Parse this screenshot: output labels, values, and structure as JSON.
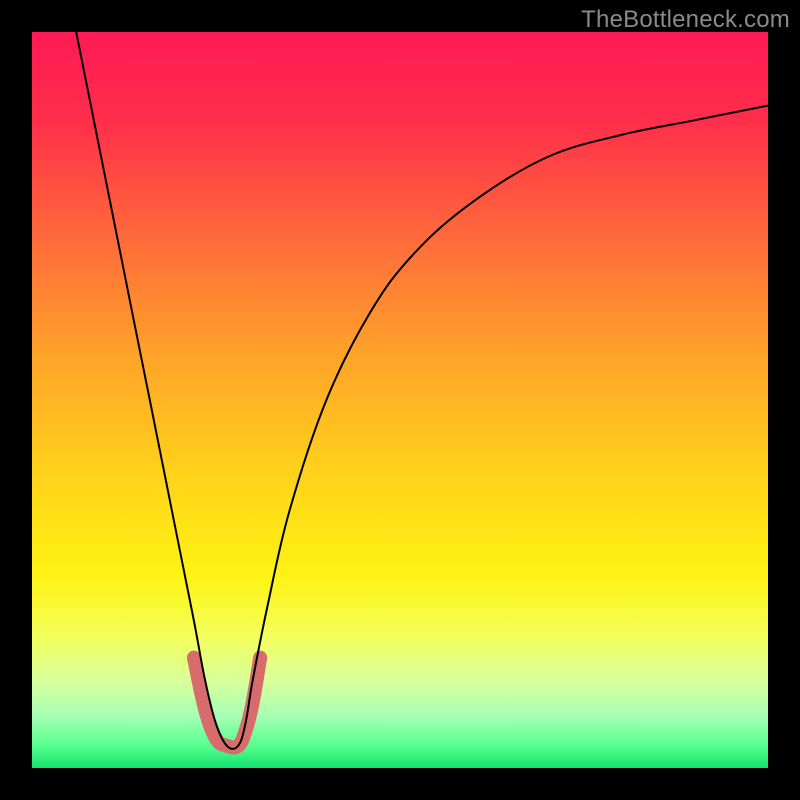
{
  "watermark": "TheBottleneck.com",
  "chart_data": {
    "type": "line",
    "title": "",
    "xlabel": "",
    "ylabel": "",
    "xlim": [
      0,
      100
    ],
    "ylim": [
      0,
      100
    ],
    "gradient_stops": [
      {
        "offset": 0.0,
        "color": "#ff1a55"
      },
      {
        "offset": 0.12,
        "color": "#ff2e4a"
      },
      {
        "offset": 0.28,
        "color": "#ff6a3a"
      },
      {
        "offset": 0.44,
        "color": "#ffa329"
      },
      {
        "offset": 0.6,
        "color": "#ffd21a"
      },
      {
        "offset": 0.74,
        "color": "#fff314"
      },
      {
        "offset": 0.82,
        "color": "#f4ff5a"
      },
      {
        "offset": 0.88,
        "color": "#d9ff9a"
      },
      {
        "offset": 0.93,
        "color": "#a6ffb4"
      },
      {
        "offset": 0.97,
        "color": "#56ff8e"
      },
      {
        "offset": 1.0,
        "color": "#12e26e"
      }
    ],
    "series": [
      {
        "name": "bottleneck-curve",
        "color": "#000000",
        "x": [
          6,
          8,
          10,
          12,
          14,
          16,
          18,
          20,
          22,
          23.5,
          25,
          26.5,
          28,
          29,
          30,
          32,
          35,
          40,
          46,
          52,
          60,
          70,
          80,
          90,
          100
        ],
        "y": [
          100,
          90,
          80,
          70,
          60,
          50,
          40,
          30,
          20,
          12,
          6,
          3,
          3,
          6,
          12,
          22,
          35,
          50,
          62,
          70,
          77,
          83,
          86,
          88,
          90
        ]
      },
      {
        "name": "highlight-u",
        "color": "#d86b6b",
        "stroke_width": 14,
        "x": [
          22,
          23.5,
          25,
          26.5,
          28,
          29,
          30,
          31
        ],
        "y": [
          15,
          8,
          4,
          3,
          3,
          5,
          9,
          15
        ]
      }
    ]
  }
}
